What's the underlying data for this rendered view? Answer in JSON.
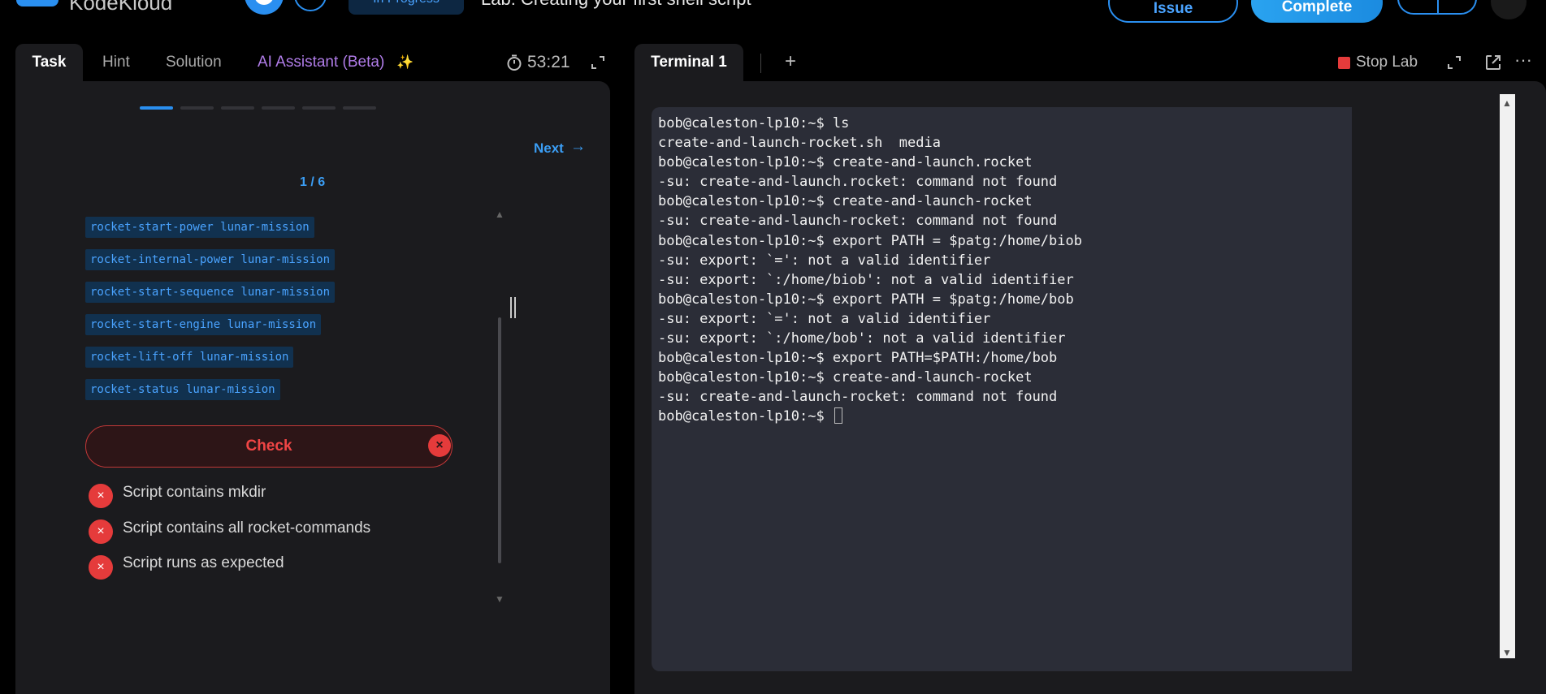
{
  "topbar": {
    "brand": "KodeKloud",
    "status_chip": "In Progress",
    "lab_title": "Lab: Creating your first shell script",
    "issue_label": "Issue",
    "complete_label": "Complete"
  },
  "left_tabs": {
    "task": "Task",
    "hint": "Hint",
    "solution": "Solution",
    "ai_assistant": "AI Assistant (Beta)",
    "timer": "53:21"
  },
  "task": {
    "next_label": "Next",
    "step_counter": "1 / 6",
    "steps_total": 6,
    "active_step": 1,
    "commands": [
      "rocket-start-power lunar-mission",
      "rocket-internal-power lunar-mission",
      "rocket-start-sequence lunar-mission",
      "rocket-start-engine lunar-mission",
      "rocket-lift-off lunar-mission",
      "rocket-status lunar-mission"
    ],
    "check_label": "Check",
    "results": [
      "Script contains mkdir",
      "Script contains all rocket-commands",
      "Script runs as expected"
    ]
  },
  "right_tabs": {
    "terminal_tab": "Terminal 1",
    "stop_lab": "Stop Lab"
  },
  "terminal": {
    "lines": [
      "bob@caleston-lp10:~$ ls",
      "create-and-launch-rocket.sh  media",
      "bob@caleston-lp10:~$ create-and-launch.rocket",
      "-su: create-and-launch.rocket: command not found",
      "bob@caleston-lp10:~$ create-and-launch-rocket",
      "-su: create-and-launch-rocket: command not found",
      "bob@caleston-lp10:~$ export PATH = $patg:/home/biob",
      "-su: export: `=': not a valid identifier",
      "-su: export: `:/home/biob': not a valid identifier",
      "bob@caleston-lp10:~$ export PATH = $patg:/home/bob",
      "-su: export: `=': not a valid identifier",
      "-su: export: `:/home/bob': not a valid identifier",
      "bob@caleston-lp10:~$ export PATH=$PATH:/home/bob",
      "bob@caleston-lp10:~$ create-and-launch-rocket",
      "-su: create-and-launch-rocket: command not found"
    ],
    "prompt": "bob@caleston-lp10:~$ "
  }
}
